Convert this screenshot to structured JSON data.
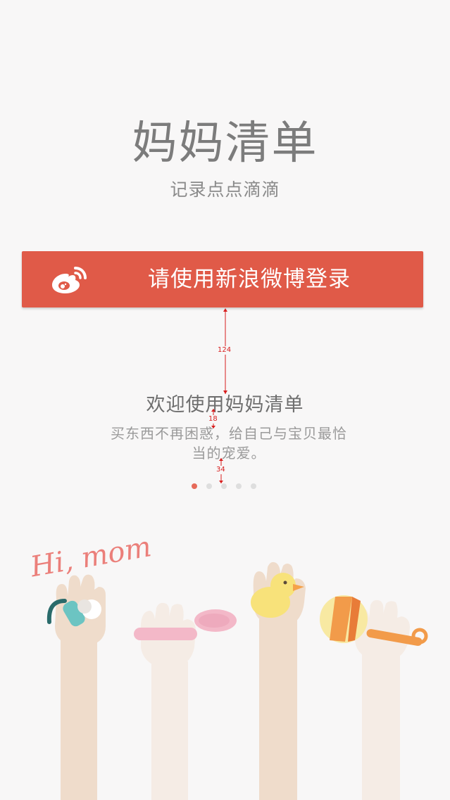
{
  "header": {
    "title": "妈妈清单",
    "subtitle": "记录点点滴滴"
  },
  "login": {
    "label": "请使用新浪微博登录",
    "icon": "weibo-icon",
    "color": "#e05a48"
  },
  "annotations": {
    "gap_button_to_title": "124",
    "gap_title_to_desc": "18",
    "gap_desc_to_dots": "34"
  },
  "onboarding": {
    "title": "欢迎使用妈妈清单",
    "description": "买东西不再困惑，给自己与宝贝最恰当的宠爱。",
    "pages": 5,
    "current_page": 1
  },
  "illustration": {
    "greeting": "Hi, mom",
    "items": [
      "pacifier-icon",
      "spoon-icon",
      "rubber-duck-icon",
      "rattle-icon"
    ]
  },
  "colors": {
    "background": "#f8f7f7",
    "accent": "#e05a48",
    "active_dot": "#e66a5a",
    "inactive_dot": "#dedede",
    "annotation": "#d81e1e"
  }
}
